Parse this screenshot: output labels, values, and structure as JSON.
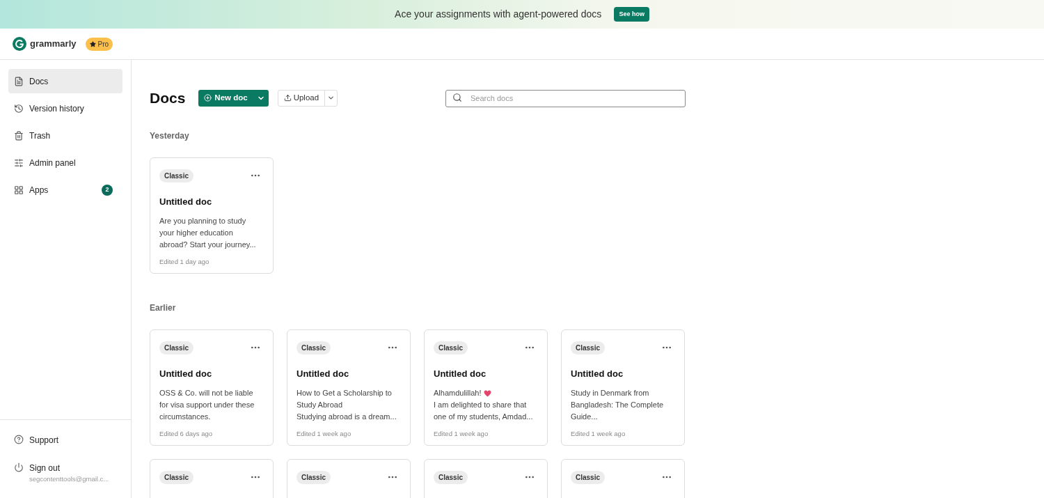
{
  "banner": {
    "text": "Ace your assignments with agent-powered docs",
    "button": "See how"
  },
  "header": {
    "logo_text": "grammarly",
    "plan_badge": "Pro"
  },
  "sidebar": {
    "items": [
      {
        "label": "Docs",
        "selected": true
      },
      {
        "label": "Version history",
        "selected": false
      },
      {
        "label": "Trash",
        "selected": false
      },
      {
        "label": "Admin panel",
        "selected": false
      },
      {
        "label": "Apps",
        "selected": false,
        "badge": "2"
      }
    ],
    "footer": [
      {
        "label": "Support"
      },
      {
        "label": "Sign out",
        "sub": "segcontenttools@gmail.c..."
      }
    ]
  },
  "main": {
    "title": "Docs",
    "new_button": "New doc",
    "upload_button": "Upload",
    "search": {
      "placeholder": "Search docs"
    },
    "sections": [
      {
        "heading": "Yesterday",
        "cards": [
          {
            "badge": "Classic",
            "title": "Untitled doc",
            "preview_lines": [
              "Are you planning to study",
              "your higher education",
              "abroad? Start your journey..."
            ],
            "edited": "Edited 1 day ago"
          }
        ]
      },
      {
        "heading": "Earlier",
        "cards": [
          {
            "badge": "Classic",
            "title": "Untitled doc",
            "preview_lines": [
              "OSS & Co. will not be liable",
              "for visa support under these",
              "circumstances."
            ],
            "edited": "Edited 6 days ago"
          },
          {
            "badge": "Classic",
            "title": "Untitled doc",
            "preview_lines": [
              "How to Get a Scholarship to",
              "Study Abroad",
              "Studying abroad is a dream..."
            ],
            "edited": "Edited 1 week ago"
          },
          {
            "badge": "Classic",
            "title": "Untitled doc",
            "preview_lines": [
              "Alhamdulillah!",
              "I am delighted to share that",
              "one of my students, Amdad..."
            ],
            "heart_after_first_line": true,
            "edited": "Edited 1 week ago"
          },
          {
            "badge": "Classic",
            "title": "Untitled doc",
            "preview_lines": [
              "Study in Denmark from",
              "Bangladesh: The Complete",
              "Guide..."
            ],
            "edited": "Edited 1 week ago"
          },
          {
            "badge": "Classic"
          },
          {
            "badge": "Classic"
          },
          {
            "badge": "Classic"
          },
          {
            "badge": "Classic"
          }
        ]
      }
    ]
  }
}
